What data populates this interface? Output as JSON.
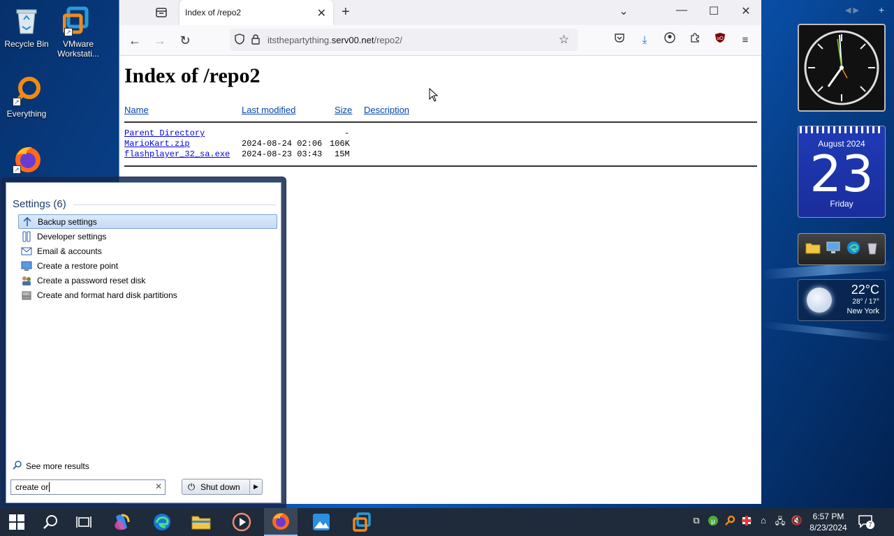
{
  "desktop": {
    "icons": [
      {
        "label": "Recycle Bin"
      },
      {
        "label": "VMware Workstati..."
      },
      {
        "label": "Everything"
      },
      {
        "label": ""
      }
    ]
  },
  "browser": {
    "tab_title": "Index of /repo2",
    "url_prefix": "itsthepartything.",
    "url_host": "serv00.net",
    "url_path": "/repo2/"
  },
  "page": {
    "heading": "Index of /repo2",
    "columns": [
      "Name",
      "Last modified",
      "Size",
      "Description"
    ],
    "rows": [
      {
        "name": "Parent Directory",
        "modified": "",
        "size": "-",
        "desc": ""
      },
      {
        "name": "MarioKart.zip",
        "modified": "2024-08-24 02:06",
        "size": "106K",
        "desc": ""
      },
      {
        "name": "flashplayer_32_sa.exe",
        "modified": "2024-08-23 03:43",
        "size": "15M",
        "desc": ""
      }
    ]
  },
  "start_menu": {
    "heading": "Settings (6)",
    "items": [
      {
        "label": "Backup settings",
        "icon": "backup-icon",
        "selected": true
      },
      {
        "label": "Developer settings",
        "icon": "developer-icon"
      },
      {
        "label": "Email & accounts",
        "icon": "mail-icon"
      },
      {
        "label": "Create a restore point",
        "icon": "restore-icon"
      },
      {
        "label": "Create a password reset disk",
        "icon": "users-icon"
      },
      {
        "label": "Create and format hard disk partitions",
        "icon": "disk-management-icon"
      }
    ],
    "see_more": "See more results",
    "search_value": "create or",
    "shutdown_label": "Shut down"
  },
  "gadgets": {
    "calendar": {
      "month": "August 2024",
      "day": "23",
      "weekday": "Friday"
    },
    "weather": {
      "temp": "22°C",
      "hilo": "28° / 17°",
      "city": "New York"
    }
  },
  "taskbar": {
    "time": "6:57 PM",
    "date": "8/23/2024",
    "notification_count": "7"
  }
}
